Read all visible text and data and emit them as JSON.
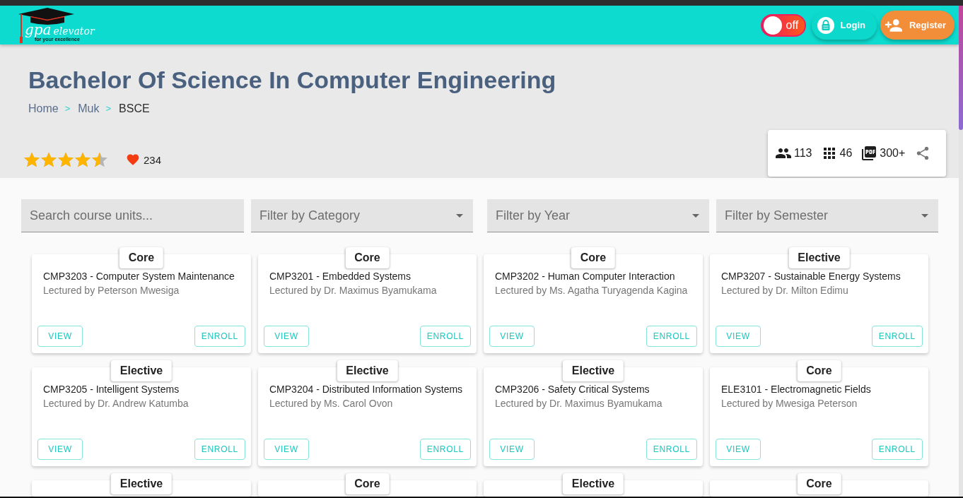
{
  "header": {
    "logo": {
      "primary": "gpa",
      "secondary": "elevator",
      "tagline": "for your excellence"
    },
    "theme_toggle": {
      "label": "off",
      "on": false
    },
    "buttons": [
      {
        "kind": "login",
        "label": "Login"
      },
      {
        "kind": "register",
        "label": "Register"
      }
    ]
  },
  "program": {
    "title": "Bachelor Of Science In Computer Engineering",
    "breadcrumb": [
      {
        "label": "Home",
        "separator": ">",
        "current": false
      },
      {
        "label": "Muk",
        "separator": ">",
        "current": false
      },
      {
        "label": "BSCE",
        "current": true
      }
    ],
    "rating": {
      "stars": 4.5,
      "likes": "234"
    },
    "stats": [
      {
        "kind": "students",
        "value": "113"
      },
      {
        "kind": "units",
        "value": "46"
      },
      {
        "kind": "documents",
        "value": "300+"
      }
    ]
  },
  "filters": [
    {
      "kind": "search",
      "placeholder": "Search course units..."
    },
    {
      "kind": "select",
      "placeholder": "Filter by Category"
    },
    {
      "kind": "select",
      "placeholder": "Filter by Year"
    },
    {
      "kind": "select",
      "placeholder": "Filter by Semester"
    }
  ],
  "course_units": [
    {
      "tag": "Core",
      "title": "CMP3203 - Computer System Maintenance",
      "lecturer": "Lectured by Peterson Mwesiga",
      "view": "VIEW",
      "enroll": "ENROLL"
    },
    {
      "tag": "Core",
      "title": "CMP3201 - Embedded Systems",
      "lecturer": "Lectured by Dr. Maximus Byamukama",
      "view": "VIEW",
      "enroll": "ENROLL"
    },
    {
      "tag": "Core",
      "title": "CMP3202 - Human Computer Interaction",
      "lecturer": "Lectured by Ms. Agatha Turyagenda Kagina",
      "view": "VIEW",
      "enroll": "ENROLL"
    },
    {
      "tag": "Elective",
      "title": "CMP3207 - Sustainable Energy Systems",
      "lecturer": "Lectured by Dr. Milton Edimu",
      "view": "VIEW",
      "enroll": "ENROLL"
    },
    {
      "tag": "Elective",
      "title": "CMP3205 - Intelligent Systems",
      "lecturer": "Lectured by Dr. Andrew Katumba",
      "view": "VIEW",
      "enroll": "ENROLL"
    },
    {
      "tag": "Elective",
      "title": "CMP3204 - Distributed Information Systems",
      "lecturer": "Lectured by Ms. Carol Ovon",
      "view": "VIEW",
      "enroll": "ENROLL"
    },
    {
      "tag": "Elective",
      "title": "CMP3206 - Safety Critical Systems",
      "lecturer": "Lectured by Dr. Maximus Byamukama",
      "view": "VIEW",
      "enroll": "ENROLL"
    },
    {
      "tag": "Core",
      "title": "ELE3101 - Electromagnetic Fields",
      "lecturer": "Lectured by Mwesiga Peterson",
      "view": "VIEW",
      "enroll": "ENROLL"
    },
    {
      "tag": "Elective"
    },
    {
      "tag": "Core"
    },
    {
      "tag": "Elective"
    },
    {
      "tag": "Core"
    }
  ]
}
